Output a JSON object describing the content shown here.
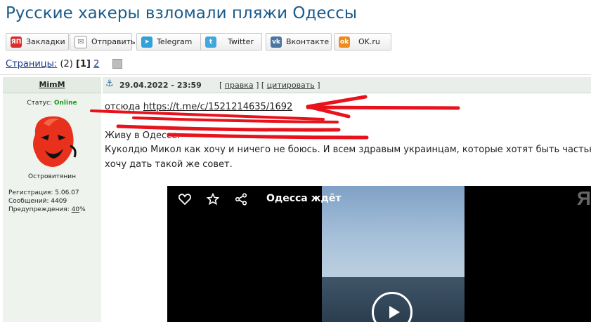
{
  "page": {
    "title": "Русские хакеры взломали пляжи Одессы"
  },
  "share": {
    "buttons": [
      {
        "label": "Закладки",
        "icon": "yandex-bookmarks-icon",
        "icon_text": "ЯП",
        "color": "#d92c2c"
      },
      {
        "label": "Отправить",
        "icon": "envelope-icon",
        "icon_text": "✉",
        "color": "#8a8a8a"
      },
      {
        "label": "Telegram",
        "icon": "telegram-icon",
        "icon_text": "➤",
        "color": "#33a0da"
      },
      {
        "label": "Twitter",
        "icon": "twitter-icon",
        "icon_text": "t",
        "color": "#41a7dd"
      },
      {
        "label": "Вконтакте",
        "icon": "vk-icon",
        "icon_text": "vk",
        "color": "#4c75a3"
      },
      {
        "label": "OK.ru",
        "icon": "odnoklassniki-icon",
        "icon_text": "ok",
        "color": "#f08a1c"
      }
    ]
  },
  "pagination": {
    "label": "Страницы:",
    "total": "(2)",
    "current": "[1]",
    "next": "2"
  },
  "post": {
    "author": "MimM",
    "status_label": "Статус:",
    "status_value": "Online",
    "rank": "Островитянин",
    "reg_label": "Регистрация:",
    "reg_value": "5.06.07",
    "messages_label": "Сообщений:",
    "messages_value": "4409",
    "warnings_label": "Предупреждения:",
    "warnings_value": "40",
    "warnings_suffix": "%",
    "date": "29.04.2022 - 23:59",
    "edit_label": "правка",
    "quote_label": "цитировать",
    "text": {
      "line1_prefix": "отсюда ",
      "line1_link": "https://t.me/c/1521214635/1692",
      "line2": "Живу в Одессе.",
      "line3": "Куколдю Микол как хочу и ничего не боюсь. И всем здравым украинцам, которые хотят быть частью",
      "line4": "хочу дать такой же совет."
    }
  },
  "video": {
    "title": "Одесса ждёт",
    "logo": "Я",
    "icons": [
      "heart-icon",
      "star-icon",
      "share-icon",
      "play-icon"
    ]
  },
  "colors": {
    "title": "#1a5b8a",
    "online": "#1c9a1c",
    "scribble": "#e8121c"
  }
}
